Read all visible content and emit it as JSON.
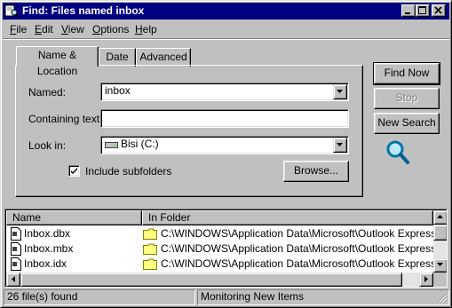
{
  "window": {
    "title": "Find: Files named inbox"
  },
  "titlebar": {
    "icons": [
      "find-app-icon",
      "minimize-icon",
      "maximize-icon",
      "close-icon"
    ]
  },
  "menu": [
    {
      "label": "File",
      "hotkey": "F",
      "rest": "ile"
    },
    {
      "label": "Edit",
      "hotkey": "E",
      "rest": "dit"
    },
    {
      "label": "View",
      "hotkey": "V",
      "rest": "iew"
    },
    {
      "label": "Options",
      "hotkey": "O",
      "rest": "ptions"
    },
    {
      "label": "Help",
      "hotkey": "H",
      "rest": "elp"
    }
  ],
  "tabs": [
    {
      "label": "Name & Location",
      "active": true
    },
    {
      "label": "Date",
      "active": false
    },
    {
      "label": "Advanced",
      "active": false
    }
  ],
  "form": {
    "named_label": "Named:",
    "named_value": "inbox",
    "containing_label": "Containing text:",
    "containing_value": "",
    "lookin_label": "Look in:",
    "lookin_value": "Bisi (C:)",
    "include_subfolders_label": "Include subfolders",
    "include_subfolders_checked": true,
    "browse_label": "Browse..."
  },
  "actions": {
    "find_now": "Find Now",
    "stop": "Stop",
    "new_search": "New Search",
    "stop_disabled": true
  },
  "results": {
    "columns": [
      "Name",
      "In Folder"
    ],
    "rows": [
      {
        "name": "Inbox.dbx",
        "folder": "C:\\WINDOWS\\Application Data\\Microsoft\\Outlook Express"
      },
      {
        "name": "Inbox.mbx",
        "folder": "C:\\WINDOWS\\Application Data\\Microsoft\\Outlook Express\\Mai"
      },
      {
        "name": "Inbox.idx",
        "folder": "C:\\WINDOWS\\Application Data\\Microsoft\\Outlook Express\\Mai"
      }
    ]
  },
  "status": {
    "count": "26 file(s) found",
    "message": "Monitoring New Items"
  },
  "colors": {
    "title_bar": "#000080",
    "face": "#c0c0c0",
    "folder_yellow": "#ffff80"
  }
}
